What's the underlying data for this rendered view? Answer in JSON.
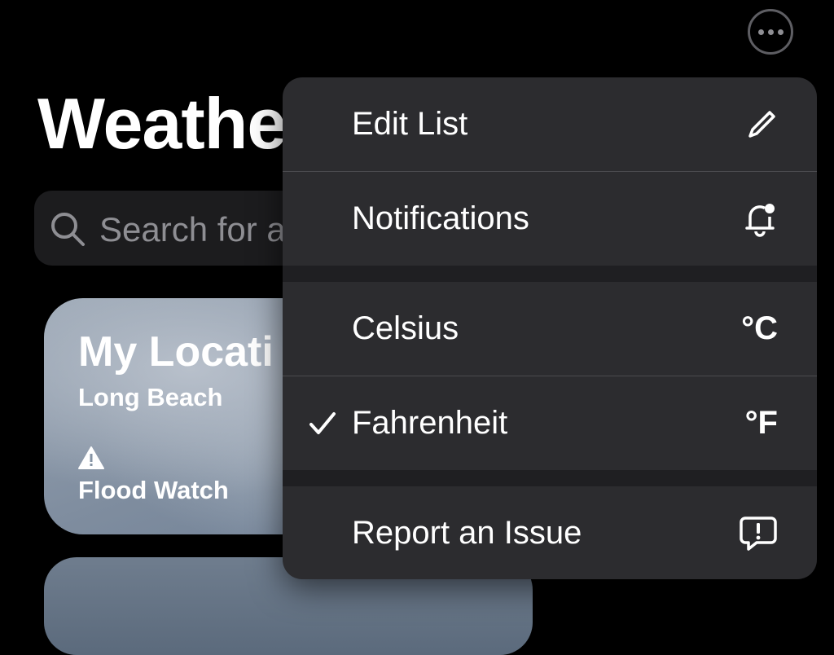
{
  "header": {
    "title": "Weathe",
    "more_icon": "ellipsis-circle-icon"
  },
  "search": {
    "placeholder": "Search for a"
  },
  "location_card": {
    "title": "My Locati",
    "subtitle": "Long Beach",
    "alert_icon": "warning-triangle-icon",
    "alert": "Flood Watch"
  },
  "menu": {
    "items": [
      {
        "label": "Edit List",
        "icon": "pencil-icon"
      },
      {
        "label": "Notifications",
        "icon": "bell-badge-icon"
      },
      {
        "label": "Celsius",
        "unit": "°C"
      },
      {
        "label": "Fahrenheit",
        "unit": "°F",
        "checked": true
      },
      {
        "label": "Report an Issue",
        "icon": "report-bubble-icon"
      }
    ]
  },
  "colors": {
    "background": "#000000",
    "menu": "#2c2c2f",
    "search": "#1c1c1e"
  }
}
